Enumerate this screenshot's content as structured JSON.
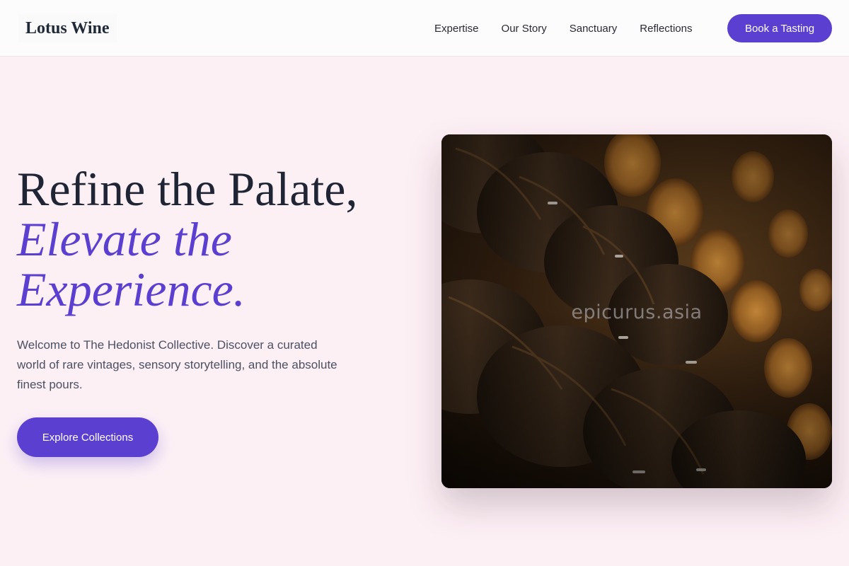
{
  "brand": {
    "name": "Lotus Wine"
  },
  "nav": {
    "items": [
      "Expertise",
      "Our Story",
      "Sanctuary",
      "Reflections"
    ],
    "cta_label": "Book a Tasting"
  },
  "hero": {
    "title_line1": "Refine the Palate,",
    "title_accent": "Elevate the Experience.",
    "description": "Welcome to The Hedonist Collective. Discover a curated world of rare vintages, sensory storytelling, and the absolute finest pours.",
    "cta_label": "Explore Collections",
    "image": {
      "subject": "wine-barrels-cellar-photo",
      "watermark": "epicurus.asia"
    }
  },
  "colors": {
    "accent": "#5b3fd0",
    "background": "#fdf0f5",
    "header_bg": "#fdfcfd",
    "heading": "#1f2535",
    "body_text": "#4b5163"
  }
}
